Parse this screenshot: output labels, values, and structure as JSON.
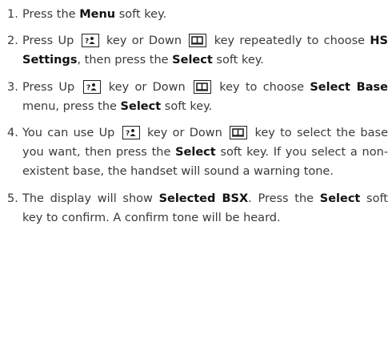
{
  "steps": [
    {
      "num": "1.",
      "parts": [
        {
          "t": "Press the "
        },
        {
          "b": "Menu"
        },
        {
          "t": " soft key."
        }
      ]
    },
    {
      "num": "2.",
      "parts": [
        {
          "t": "Press Up "
        },
        {
          "icon": "up-key-icon"
        },
        {
          "t": " key or Down "
        },
        {
          "icon": "down-key-icon"
        },
        {
          "t": " key repeatedly to choose "
        },
        {
          "b": "HS Settings"
        },
        {
          "t": ", then press the "
        },
        {
          "b": "Select"
        },
        {
          "t": " soft key."
        }
      ]
    },
    {
      "num": "3.",
      "parts": [
        {
          "t": "Press Up "
        },
        {
          "icon": "up-key-icon"
        },
        {
          "t": " key or Down "
        },
        {
          "icon": "down-key-icon"
        },
        {
          "t": " key to choose "
        },
        {
          "b": "Select Base"
        },
        {
          "t": " menu, press the "
        },
        {
          "b": "Select"
        },
        {
          "t": " soft key."
        }
      ]
    },
    {
      "num": "4.",
      "parts": [
        {
          "t": "You can use Up "
        },
        {
          "icon": "up-key-icon"
        },
        {
          "t": " key or Down "
        },
        {
          "icon": "down-key-icon"
        },
        {
          "t": " key to select the base you want, then press the "
        },
        {
          "b": "Select"
        },
        {
          "t": " soft key. If you select a non-existent base, the handset will sound a warning tone."
        }
      ]
    },
    {
      "num": "5.",
      "parts": [
        {
          "t": "The display will show "
        },
        {
          "b": "Selected BSX"
        },
        {
          "t": ". Press the "
        },
        {
          "b": "Select"
        },
        {
          "t": " soft key to confirm. A confirm tone will be heard."
        }
      ]
    }
  ]
}
